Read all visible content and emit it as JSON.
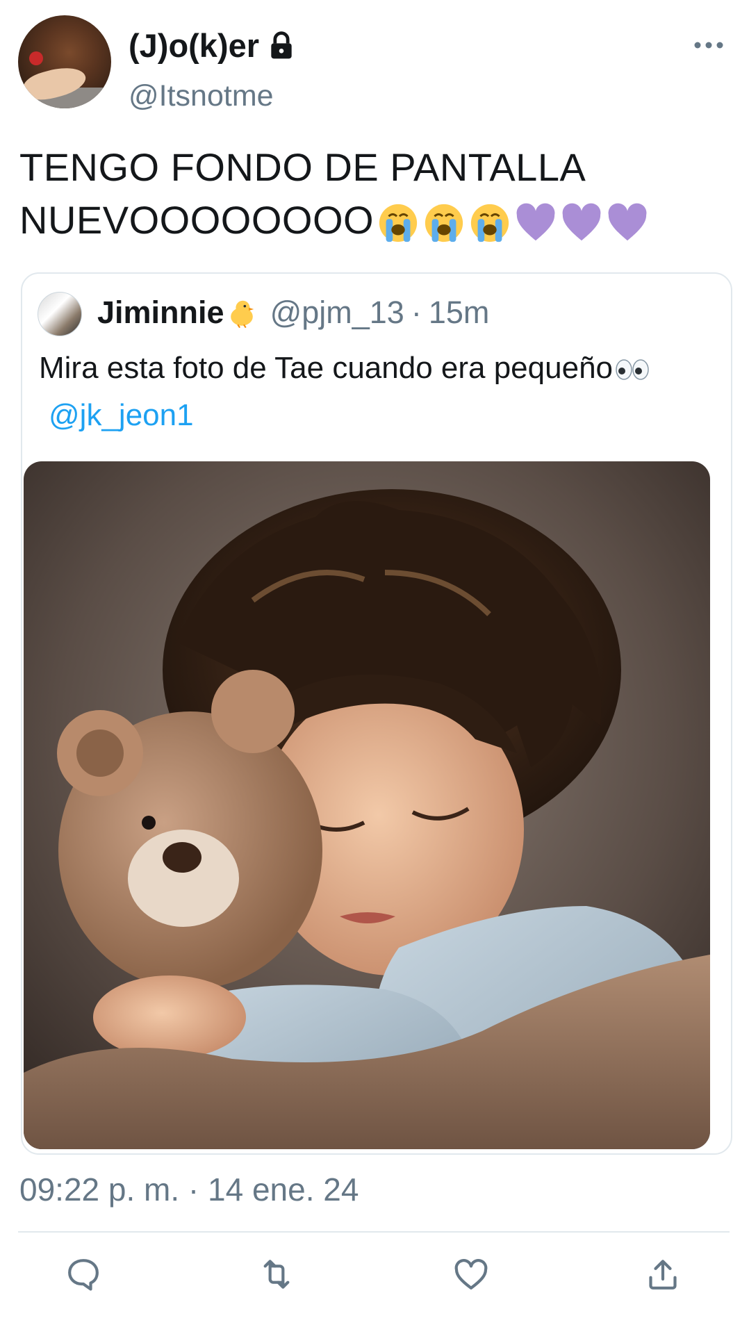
{
  "author": {
    "display_name": "(J)o(k)er",
    "handle": "@Itsnotme",
    "protected": true
  },
  "tweet": {
    "text": "TENGO FONDO DE PANTALLA NUEVOOOOOOOO",
    "emojis": [
      "loudly-crying-face",
      "loudly-crying-face",
      "loudly-crying-face",
      "purple-heart",
      "purple-heart",
      "purple-heart"
    ],
    "timestamp": "09:22 p. m. · 14 ene. 24"
  },
  "quoted_tweet": {
    "display_name": "Jiminnie",
    "name_emoji": "baby-chick",
    "handle": "@pjm_13",
    "separator": "·",
    "time": "15m",
    "text": "Mira esta foto de Tae cuando era pequeño",
    "text_emoji": "eyes",
    "mention": "@jk_jeon1",
    "media": "photo-sleeping-child-with-teddy-bear"
  },
  "actions": [
    "reply-icon",
    "retweet-icon",
    "like-icon",
    "share-icon"
  ],
  "colors": {
    "text": "#14171a",
    "secondary": "#657786",
    "link": "#1da1f2",
    "border": "#e1e8ed"
  }
}
